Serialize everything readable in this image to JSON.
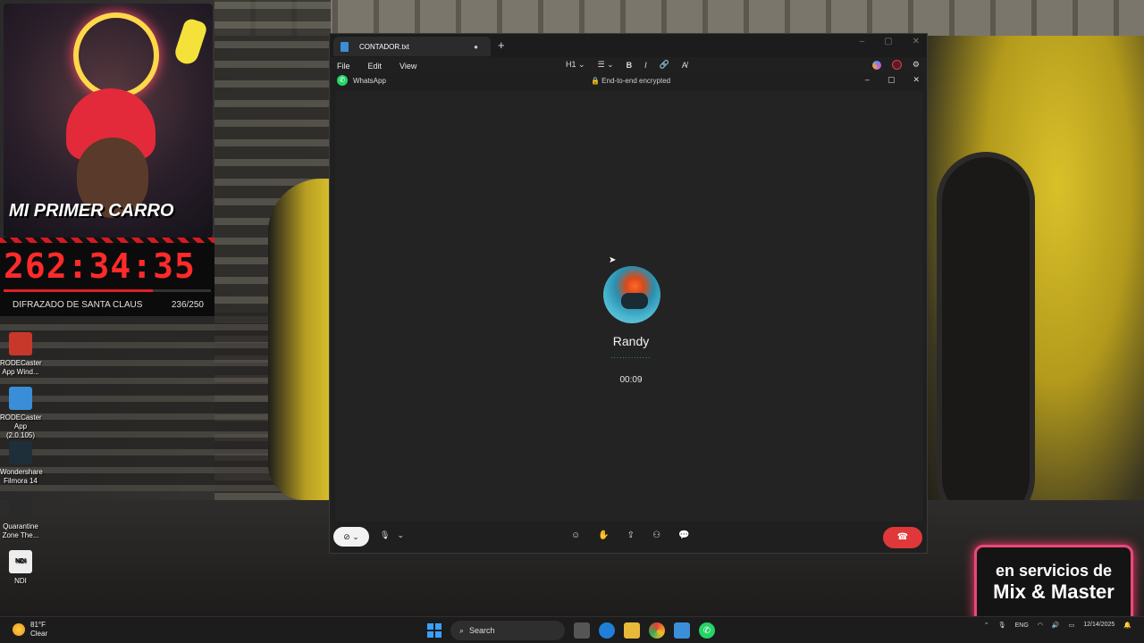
{
  "stream_overlay": {
    "webcam_title": "MI PRIMER CARRO",
    "timer": "262:34:35",
    "progress_fraction": 0.72,
    "goal_label": "DIFRAZADO DE SANTA CLAUS",
    "goal_count": "236/250"
  },
  "desktop_icons": [
    {
      "label": "RODECaster App Wind...",
      "color": "#c8382a"
    },
    {
      "label": "RODECaster App (2.0.105)",
      "color": "#3a8ed8"
    },
    {
      "label": "Wondershare Filmora 14",
      "color": "#1f2f3a"
    },
    {
      "label": "Quarantine Zone The...",
      "color": "#2a2a2a"
    },
    {
      "label": "NDI",
      "color": "#eeeeee"
    }
  ],
  "notepad": {
    "tab_title": "CONTADOR.txt",
    "tab_modified": "●",
    "new_tab": "+",
    "menu": [
      "File",
      "Edit",
      "View"
    ],
    "heading_tool": "H1 ⌄",
    "list_tool": "☰ ⌄",
    "bold_tool": "B",
    "italic_tool": "I",
    "link_tool": "🔗",
    "clear_format_tool": "A̸",
    "window_controls": [
      "–",
      "▢",
      "✕"
    ]
  },
  "whatsapp_call": {
    "app_title": "WhatsApp",
    "encryption": "🔒 End-to-end encrypted",
    "window_controls": [
      "–",
      "▢",
      "✕"
    ],
    "caller_name": "Randy",
    "status_dots": "..............",
    "duration": "00:09",
    "camera_toggle": "⊘ ⌄",
    "mic_toggle": [
      "🎙",
      "⌄"
    ],
    "controls": [
      "☺",
      "✋",
      "⇪",
      "⚇",
      "💬"
    ],
    "end_call": "☎",
    "colors": {
      "accent": "#25d366",
      "end_call": "#e0373a"
    }
  },
  "promo": {
    "line1": "en servicios de",
    "line2": "Mix & Master"
  },
  "taskbar": {
    "temperature": "81°F",
    "condition": "Clear",
    "search_placeholder": "Search",
    "language": "ENG",
    "date": "12/14/2025"
  }
}
